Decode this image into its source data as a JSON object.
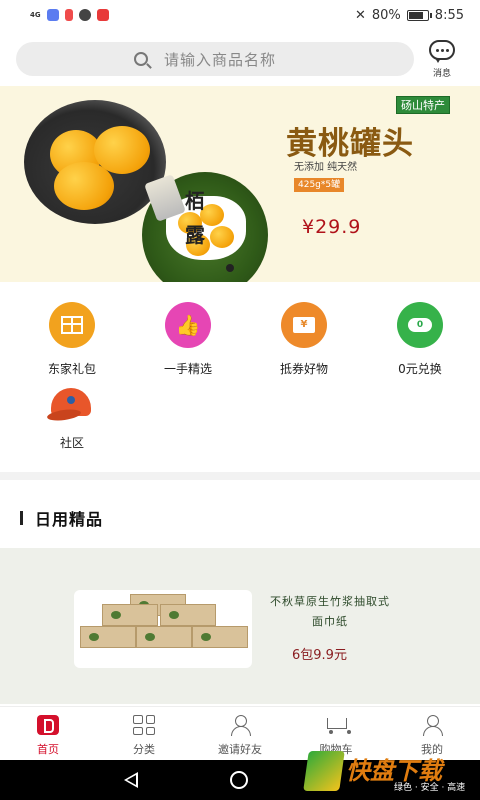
{
  "status_bar": {
    "network": "4G",
    "battery": "80%",
    "battery_level": 0.8,
    "time": "8:55"
  },
  "search": {
    "placeholder": "请输入商品名称"
  },
  "messages": {
    "label": "消息",
    "icon": "chat-bubble-icon"
  },
  "banner": {
    "calligraphy": "栢露",
    "origin_tag": "砀山特产",
    "title": "黄桃罐头",
    "subtitle": "无添加  纯天然",
    "spec": "425g*5罐",
    "price": "¥29.9"
  },
  "quick_menu": {
    "items": [
      {
        "label": "东家礼包",
        "icon": "gift-icon",
        "color": "#f2a21e"
      },
      {
        "label": "一手精选",
        "icon": "thumbs-up-icon",
        "color": "#e646b4"
      },
      {
        "label": "抵券好物",
        "icon": "coupon-icon",
        "color": "#ee8a2a"
      },
      {
        "label": "0元兑换",
        "icon": "zero-yuan-icon",
        "color": "#36b24a"
      },
      {
        "label": "社区",
        "icon": "cap-icon",
        "color": "#e8562a"
      }
    ]
  },
  "section": {
    "title": "日用精品"
  },
  "product": {
    "name": "不秋草原生竹浆抽取式面巾纸",
    "price": "6包9.9元"
  },
  "tabbar": {
    "tabs": [
      {
        "label": "首页",
        "icon": "home-icon",
        "active": true
      },
      {
        "label": "分类",
        "icon": "category-icon",
        "active": false
      },
      {
        "label": "邀请好友",
        "icon": "invite-friend-icon",
        "active": false
      },
      {
        "label": "购物车",
        "icon": "cart-icon",
        "active": false
      },
      {
        "label": "我的",
        "icon": "profile-icon",
        "active": false
      }
    ]
  },
  "watermark": {
    "brand": "快盘下载",
    "tagline": "绿色 · 安全 · 高速"
  },
  "colors": {
    "accent": "#d4102c",
    "banner_bg": "#fbf6df",
    "price_red": "#b0121a"
  }
}
